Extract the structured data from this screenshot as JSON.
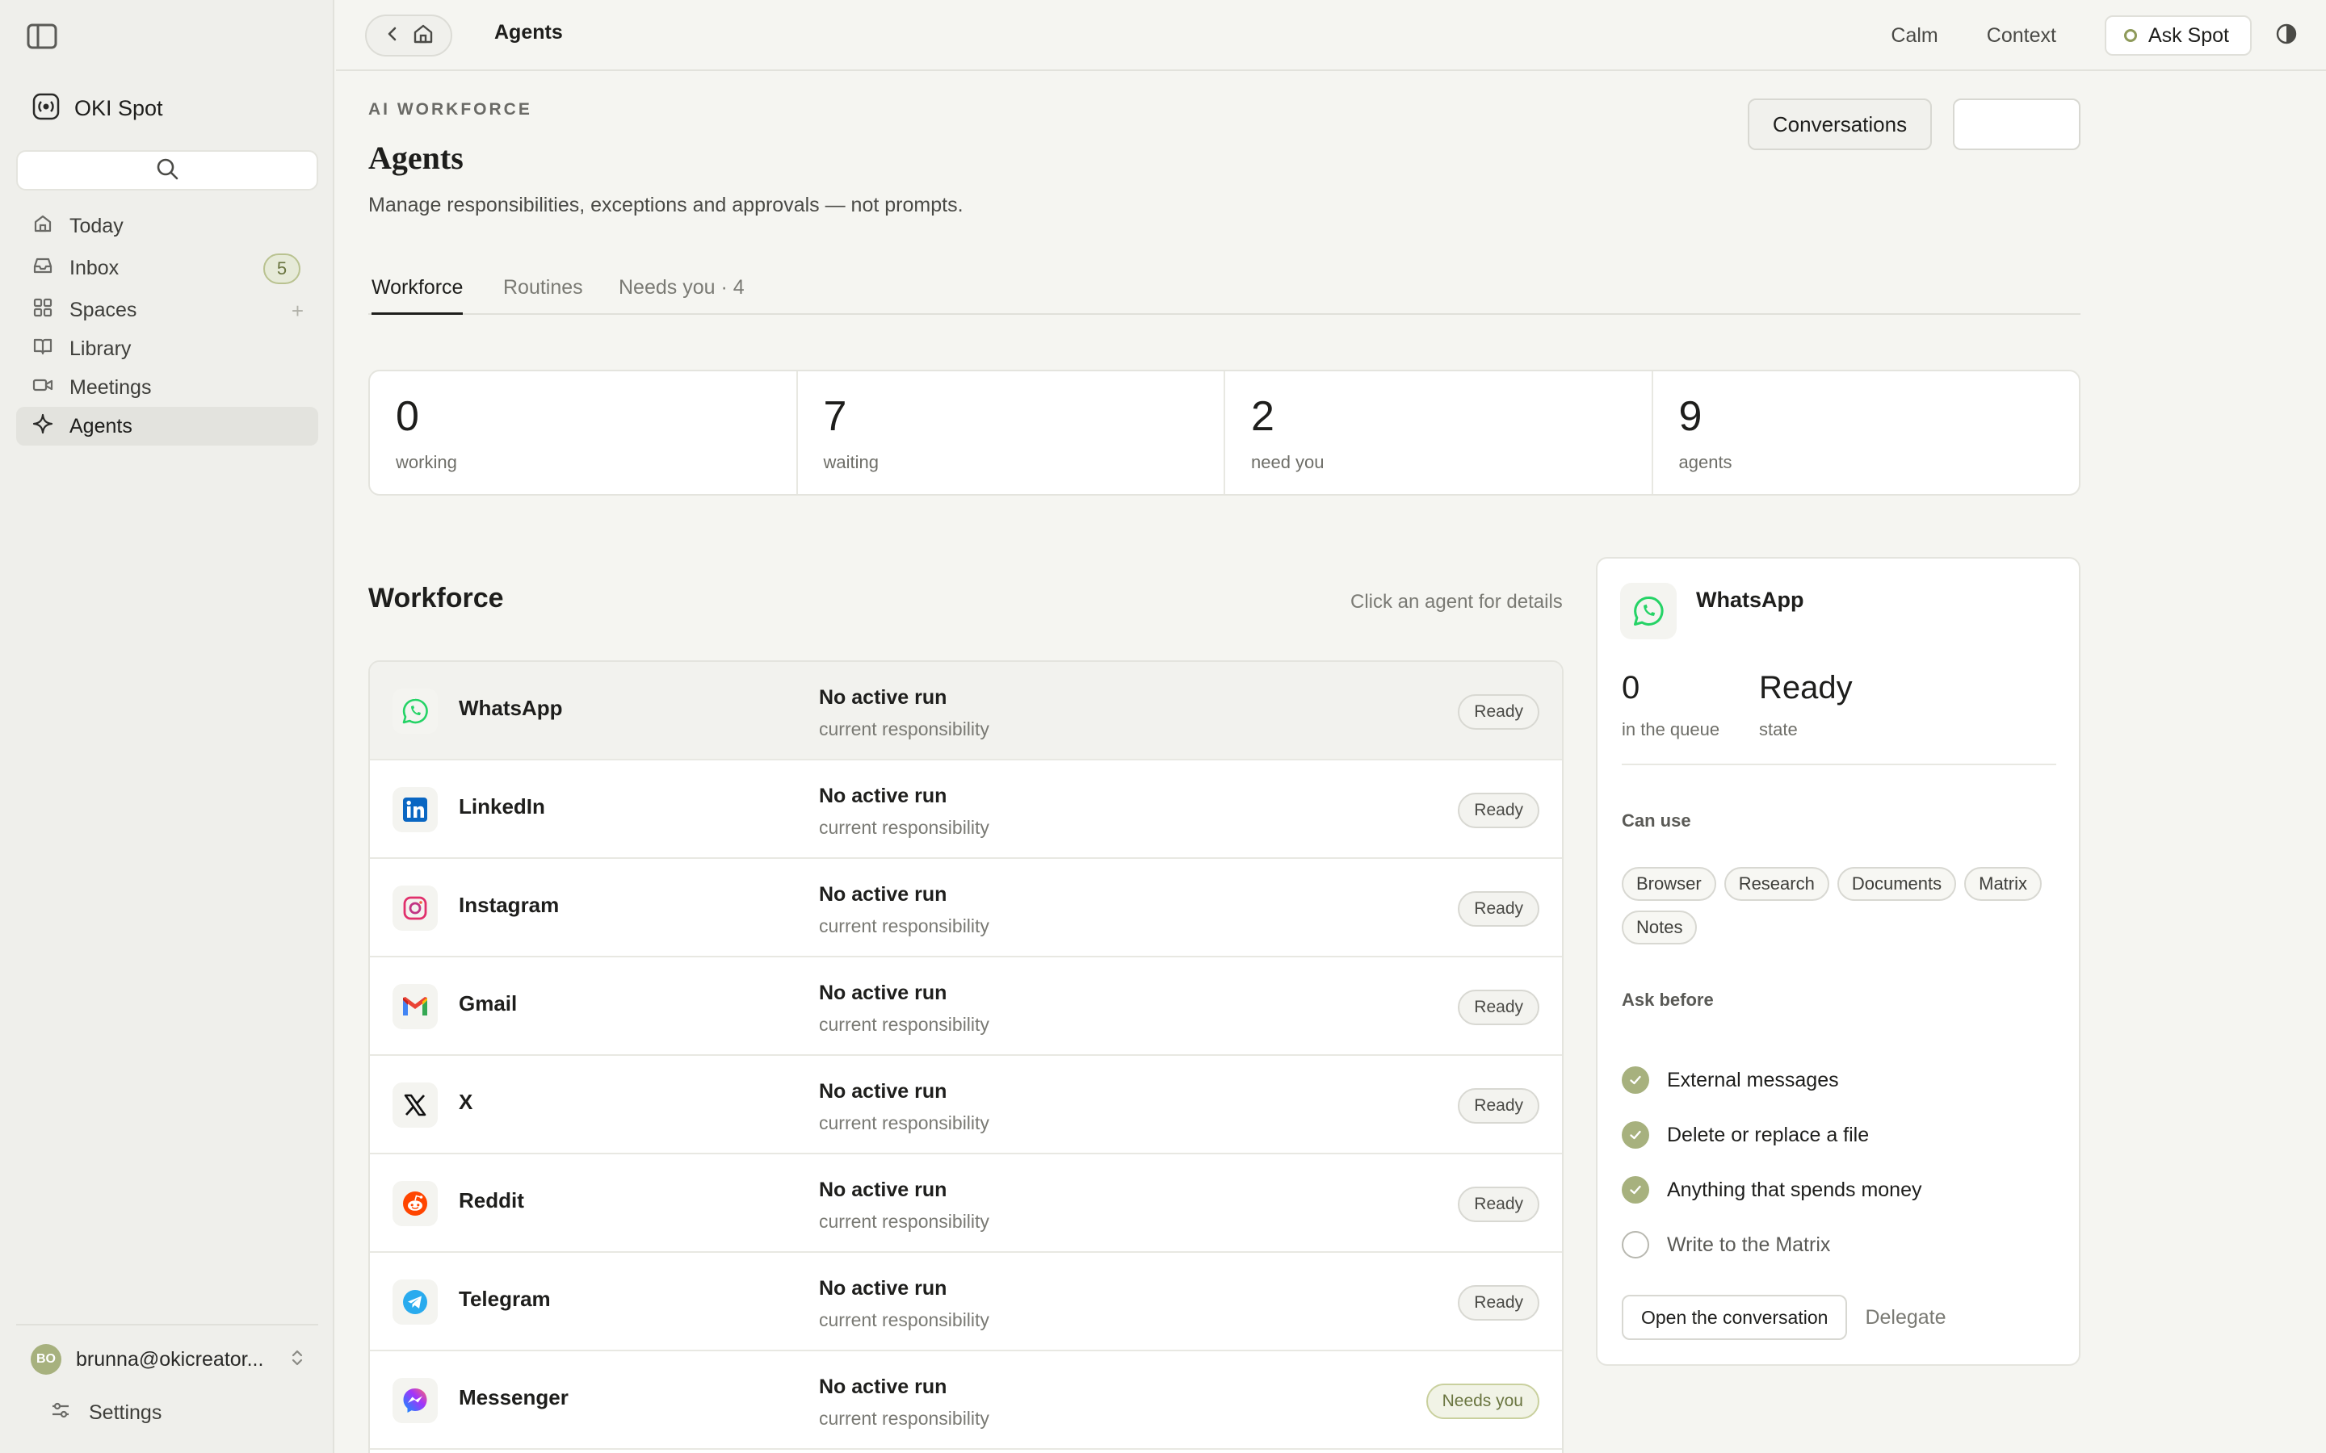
{
  "sidebar": {
    "brand": "OKI Spot",
    "items": [
      {
        "label": "Today",
        "icon": "home-icon"
      },
      {
        "label": "Inbox",
        "icon": "inbox-icon",
        "badge": "5"
      },
      {
        "label": "Spaces",
        "icon": "grid-icon"
      },
      {
        "label": "Library",
        "icon": "book-icon"
      },
      {
        "label": "Meetings",
        "icon": "video-icon"
      },
      {
        "label": "Agents",
        "icon": "sparkle-icon",
        "active": true
      }
    ],
    "user_initials": "BO",
    "user_email": "brunna@okicreator...",
    "settings_label": "Settings"
  },
  "topbar": {
    "title": "Agents",
    "calm": "Calm",
    "context": "Context",
    "ask": "Ask Spot"
  },
  "header": {
    "eyebrow": "AI WORKFORCE",
    "title": "Agents",
    "subtitle": "Manage responsibilities, exceptions and approvals — not prompts.",
    "conversations_button": "Conversations"
  },
  "tabs": [
    "Workforce",
    "Routines",
    "Needs you · 4"
  ],
  "stats": [
    {
      "value": "0",
      "label": "working"
    },
    {
      "value": "7",
      "label": "waiting"
    },
    {
      "value": "2",
      "label": "need you"
    },
    {
      "value": "9",
      "label": "agents"
    }
  ],
  "workforce": {
    "title": "Workforce",
    "hint": "Click an agent for details",
    "agents": [
      {
        "name": "WhatsApp",
        "run": "No active run",
        "resp": "current responsibility",
        "status": "Ready",
        "icon": "whatsapp-icon",
        "color": "#25D366"
      },
      {
        "name": "LinkedIn",
        "run": "No active run",
        "resp": "current responsibility",
        "status": "Ready",
        "icon": "linkedin-icon",
        "color": "#0A66C2"
      },
      {
        "name": "Instagram",
        "run": "No active run",
        "resp": "current responsibility",
        "status": "Ready",
        "icon": "instagram-icon",
        "color": "#E1306C"
      },
      {
        "name": "Gmail",
        "run": "No active run",
        "resp": "current responsibility",
        "status": "Ready",
        "icon": "gmail-icon",
        "color": "#EA4335"
      },
      {
        "name": "X",
        "run": "No active run",
        "resp": "current responsibility",
        "status": "Ready",
        "icon": "x-icon",
        "color": "#111111"
      },
      {
        "name": "Reddit",
        "run": "No active run",
        "resp": "current responsibility",
        "status": "Ready",
        "icon": "reddit-icon",
        "color": "#FF4500"
      },
      {
        "name": "Telegram",
        "run": "No active run",
        "resp": "current responsibility",
        "status": "Ready",
        "icon": "telegram-icon",
        "color": "#2AABEE"
      },
      {
        "name": "Messenger",
        "run": "No active run",
        "resp": "current responsibility",
        "status": "Needs you",
        "icon": "messenger-icon",
        "color": "#A033FF"
      }
    ]
  },
  "detail": {
    "name": "WhatsApp",
    "queue_value": "0",
    "queue_label": "in the queue",
    "state_value": "Ready",
    "state_label": "state",
    "can_use_title": "Can use",
    "can_use": [
      "Browser",
      "Research",
      "Documents",
      "Matrix",
      "Notes"
    ],
    "ask_before_title": "Ask before",
    "ask_before": [
      {
        "label": "External messages",
        "checked": true
      },
      {
        "label": "Delete or replace a file",
        "checked": true
      },
      {
        "label": "Anything that spends money",
        "checked": true
      },
      {
        "label": "Write to the Matrix",
        "checked": false
      }
    ],
    "open_button": "Open the conversation",
    "delegate": "Delegate"
  }
}
